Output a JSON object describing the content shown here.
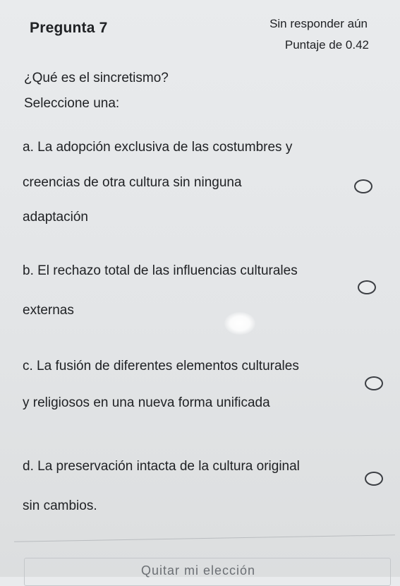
{
  "header": {
    "question_number": "Pregunta 7",
    "status": "Sin responder aún",
    "score": "Puntaje de 0.42"
  },
  "question": {
    "text": "¿Qué es el sincretismo?",
    "prompt": "Seleccione una:"
  },
  "options": [
    {
      "lines": [
        "a. La adopción exclusiva de las costumbres y",
        "creencias de otra cultura sin ninguna",
        "adaptación"
      ],
      "selected": false
    },
    {
      "lines": [
        "b. El rechazo total de las influencias culturales",
        "externas"
      ],
      "selected": false
    },
    {
      "lines": [
        "c. La fusión de diferentes elementos culturales",
        "y religiosos en una nueva forma unificada"
      ],
      "selected": false
    },
    {
      "lines": [
        "d. La preservación intacta de la cultura original",
        "sin cambios."
      ],
      "selected": false
    }
  ],
  "footer": {
    "clear_choice": "Quitar mi elección"
  }
}
